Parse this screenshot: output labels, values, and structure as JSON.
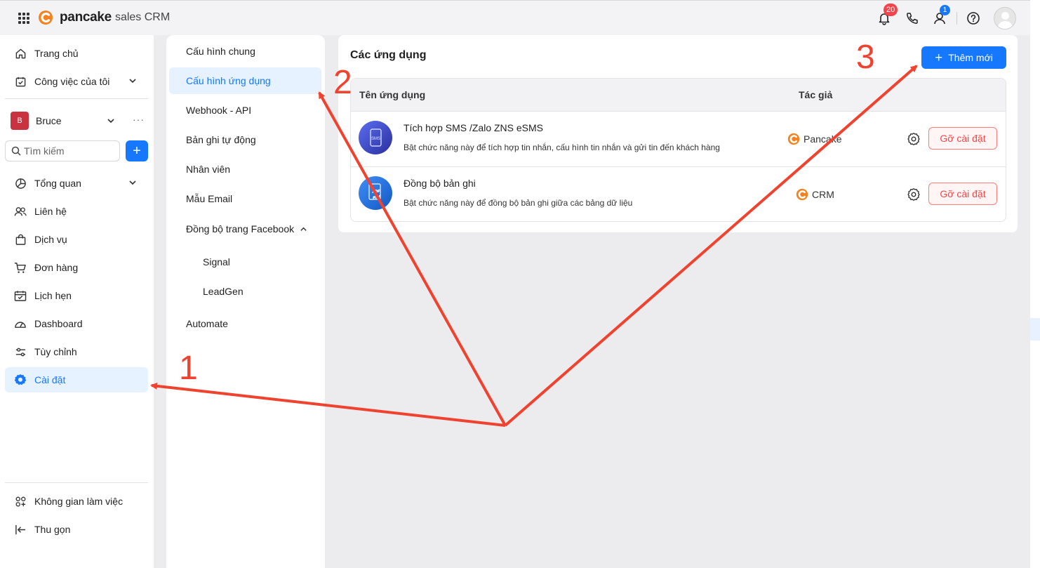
{
  "topbar": {
    "brand": "pancake",
    "brand_sub": "sales CRM",
    "notification_count": "20",
    "contacts_count": "1"
  },
  "sidebar": {
    "home": "Trang chủ",
    "my_tasks": "Công việc của tôi",
    "workspace_initial": "B",
    "workspace_name": "Bruce",
    "workspace_more": "···",
    "search_placeholder": "Tìm kiếm",
    "add": "+",
    "items": [
      {
        "label": "Tổng quan"
      },
      {
        "label": "Liên hệ"
      },
      {
        "label": "Dịch vụ"
      },
      {
        "label": "Đơn hàng"
      },
      {
        "label": "Lịch hẹn"
      },
      {
        "label": "Dashboard"
      },
      {
        "label": "Tùy chỉnh"
      },
      {
        "label": "Cài đặt"
      }
    ],
    "workspace_switch": "Không gian làm việc",
    "collapse": "Thu gọn"
  },
  "submenu": {
    "items": [
      {
        "label": "Cấu hình chung"
      },
      {
        "label": "Cấu hình ứng dụng"
      },
      {
        "label": "Webhook - API"
      },
      {
        "label": "Bản ghi tự động"
      },
      {
        "label": "Nhân viên"
      },
      {
        "label": "Mẫu Email"
      },
      {
        "label": "Đồng bộ trang Facebook"
      },
      {
        "label": "Signal"
      },
      {
        "label": "LeadGen"
      },
      {
        "label": "Automate"
      }
    ]
  },
  "main": {
    "title": "Các ứng dụng",
    "add_button": "Thêm mới",
    "columns": [
      "Tên ứng dụng",
      "Tác giả"
    ],
    "rows": [
      {
        "icon_text": "SMS",
        "name": "Tích hợp SMS /Zalo ZNS eSMS",
        "desc": "Bật chức năng này để tích hợp tin nhắn, cấu hình tin nhắn và gửi tin đến khách hàng",
        "author": "Pancake",
        "action": "Gỡ cài đặt"
      },
      {
        "name": "Đồng bộ bản ghi",
        "desc": "Bật chức năng này để đồng bộ bản ghi giữa các bảng dữ liệu",
        "author": "CRM",
        "action": "Gỡ cài đặt"
      }
    ]
  },
  "annotations": {
    "step1": "1",
    "step2": "2",
    "step3": "3",
    "arrow_color": "#f0432f"
  },
  "colors": {
    "primary": "#1677ff",
    "danger": "#f04848",
    "brand_orange": "#f5821f"
  }
}
